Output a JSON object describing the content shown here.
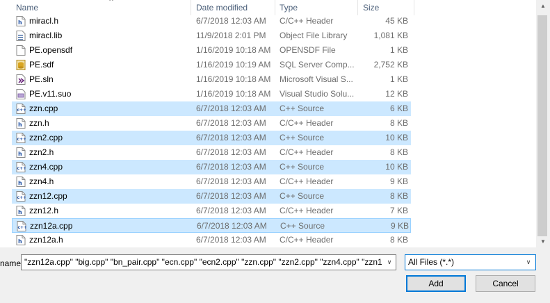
{
  "columns": {
    "name": "Name",
    "date": "Date modified",
    "type": "Type",
    "size": "Size"
  },
  "files": [
    {
      "name": "miracl.h",
      "date": "6/7/2018 12:03 AM",
      "type": "C/C++ Header",
      "size": "45 KB",
      "icon": "header-file-icon",
      "state": ""
    },
    {
      "name": "miracl.lib",
      "date": "11/9/2018 2:01 PM",
      "type": "Object File Library",
      "size": "1,081 KB",
      "icon": "library-file-icon",
      "state": ""
    },
    {
      "name": "PE.opensdf",
      "date": "1/16/2019 10:18 AM",
      "type": "OPENSDF File",
      "size": "1 KB",
      "icon": "blank-file-icon",
      "state": ""
    },
    {
      "name": "PE.sdf",
      "date": "1/16/2019 10:19 AM",
      "type": "SQL Server Comp...",
      "size": "2,752 KB",
      "icon": "database-file-icon",
      "state": ""
    },
    {
      "name": "PE.sln",
      "date": "1/16/2019 10:18 AM",
      "type": "Microsoft Visual S...",
      "size": "1 KB",
      "icon": "visual-studio-solution-icon",
      "state": ""
    },
    {
      "name": "PE.v11.suo",
      "date": "1/16/2019 10:18 AM",
      "type": "Visual Studio Solu...",
      "size": "12 KB",
      "icon": "suo-file-icon",
      "state": ""
    },
    {
      "name": "zzn.cpp",
      "date": "6/7/2018 12:03 AM",
      "type": "C++ Source",
      "size": "6 KB",
      "icon": "cpp-file-icon",
      "state": "sel"
    },
    {
      "name": "zzn.h",
      "date": "6/7/2018 12:03 AM",
      "type": "C/C++ Header",
      "size": "8 KB",
      "icon": "header-file-icon",
      "state": ""
    },
    {
      "name": "zzn2.cpp",
      "date": "6/7/2018 12:03 AM",
      "type": "C++ Source",
      "size": "10 KB",
      "icon": "cpp-file-icon",
      "state": "sel"
    },
    {
      "name": "zzn2.h",
      "date": "6/7/2018 12:03 AM",
      "type": "C/C++ Header",
      "size": "8 KB",
      "icon": "header-file-icon",
      "state": ""
    },
    {
      "name": "zzn4.cpp",
      "date": "6/7/2018 12:03 AM",
      "type": "C++ Source",
      "size": "10 KB",
      "icon": "cpp-file-icon",
      "state": "sel"
    },
    {
      "name": "zzn4.h",
      "date": "6/7/2018 12:03 AM",
      "type": "C/C++ Header",
      "size": "9 KB",
      "icon": "header-file-icon",
      "state": ""
    },
    {
      "name": "zzn12.cpp",
      "date": "6/7/2018 12:03 AM",
      "type": "C++ Source",
      "size": "8 KB",
      "icon": "cpp-file-icon",
      "state": "sel"
    },
    {
      "name": "zzn12.h",
      "date": "6/7/2018 12:03 AM",
      "type": "C/C++ Header",
      "size": "7 KB",
      "icon": "header-file-icon",
      "state": ""
    },
    {
      "name": "zzn12a.cpp",
      "date": "6/7/2018 12:03 AM",
      "type": "C++ Source",
      "size": "9 KB",
      "icon": "cpp-file-icon",
      "state": "focus"
    },
    {
      "name": "zzn12a.h",
      "date": "6/7/2018 12:03 AM",
      "type": "C/C++ Header",
      "size": "8 KB",
      "icon": "header-file-icon",
      "state": ""
    }
  ],
  "filename": {
    "label": "name:",
    "value": "\"zzn12a.cpp\" \"big.cpp\" \"bn_pair.cpp\" \"ecn.cpp\" \"ecn2.cpp\" \"zzn.cpp\" \"zzn2.cpp\" \"zzn4.cpp\" \"zzn1"
  },
  "filter": {
    "selected": "All Files (*.*)"
  },
  "buttons": {
    "add": "Add",
    "cancel": "Cancel"
  },
  "colors": {
    "selection": "#cce8ff",
    "focus_border": "#99d1ff",
    "accent": "#0078d7"
  }
}
